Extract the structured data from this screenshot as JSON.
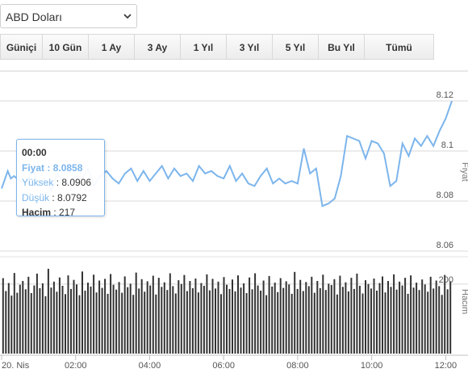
{
  "currency_select": {
    "value": "ABD Doları"
  },
  "range_tabs": [
    {
      "label": "Güniçi",
      "active": true
    },
    {
      "label": "10 Gün",
      "active": false
    },
    {
      "label": "1 Ay",
      "active": false
    },
    {
      "label": "3 Ay",
      "active": false
    },
    {
      "label": "1 Yıl",
      "active": false
    },
    {
      "label": "3 Yıl",
      "active": false
    },
    {
      "label": "5 Yıl",
      "active": false
    },
    {
      "label": "Bu Yıl",
      "active": false
    },
    {
      "label": "Tümü",
      "active": false
    }
  ],
  "tooltip": {
    "time": "00:00",
    "price_label": "Fiyat",
    "price_value": "8.0858",
    "high_label": "Yüksek",
    "high_value": "8.0906",
    "low_label": "Düşük",
    "low_value": "8.0792",
    "volume_label": "Hacim",
    "volume_value": "217"
  },
  "chart_data": [
    {
      "type": "line",
      "ylabel": "Fiyat",
      "ylim": [
        8.06,
        8.13
      ],
      "yticks": [
        "8.06",
        "8.08",
        "8.1",
        "8.12"
      ],
      "color": "#7cb5ec",
      "x": [
        "00:00",
        "00:10",
        "00:15",
        "00:20",
        "00:30",
        "00:40",
        "00:50",
        "01:00",
        "01:10",
        "01:20",
        "01:30",
        "01:40",
        "01:50",
        "02:00",
        "02:10",
        "02:20",
        "02:30",
        "02:40",
        "02:50",
        "03:00",
        "03:10",
        "03:20",
        "03:30",
        "03:40",
        "03:50",
        "04:00",
        "04:10",
        "04:20",
        "04:30",
        "04:40",
        "04:50",
        "05:00",
        "05:10",
        "05:20",
        "05:30",
        "05:40",
        "05:50",
        "06:00",
        "06:10",
        "06:20",
        "06:30",
        "06:40",
        "06:50",
        "07:00",
        "07:10",
        "07:20",
        "07:30",
        "07:40",
        "07:50",
        "08:00",
        "08:10",
        "08:20",
        "08:30",
        "08:40",
        "08:50",
        "09:00",
        "09:10",
        "09:20",
        "09:30",
        "09:40",
        "09:50",
        "10:00",
        "10:10",
        "10:20",
        "10:30",
        "10:40",
        "10:50",
        "11:00",
        "11:10",
        "11:20",
        "11:30",
        "11:40",
        "11:50",
        "12:00",
        "12:10"
      ],
      "values": [
        8.085,
        8.092,
        8.089,
        8.09,
        8.088,
        8.087,
        8.093,
        8.086,
        8.089,
        8.084,
        8.091,
        8.088,
        8.087,
        8.09,
        8.089,
        8.093,
        8.086,
        8.09,
        8.092,
        8.089,
        8.087,
        8.091,
        8.093,
        8.088,
        8.092,
        8.088,
        8.091,
        8.094,
        8.089,
        8.093,
        8.09,
        8.091,
        8.088,
        8.094,
        8.091,
        8.092,
        8.09,
        8.089,
        8.094,
        8.088,
        8.091,
        8.087,
        8.086,
        8.09,
        8.093,
        8.087,
        8.089,
        8.087,
        8.088,
        8.087,
        8.101,
        8.091,
        8.093,
        8.078,
        8.079,
        8.081,
        8.09,
        8.106,
        8.105,
        8.104,
        8.097,
        8.104,
        8.103,
        8.099,
        8.086,
        8.088,
        8.103,
        8.098,
        8.105,
        8.102,
        8.106,
        8.102,
        8.108,
        8.113,
        8.12
      ],
      "xticks": [
        "20. Nis",
        "02:00",
        "04:00",
        "06:00",
        "08:00",
        "10:00",
        "12:00"
      ],
      "xtick_values": [
        "00:00",
        "02:00",
        "04:00",
        "06:00",
        "08:00",
        "10:00",
        "12:00"
      ]
    },
    {
      "type": "bar",
      "ylabel": "Hacim",
      "ylim": [
        0,
        260
      ],
      "yticks": [
        "200"
      ],
      "color": "#333333",
      "values": [
        217,
        180,
        203,
        167,
        232,
        175,
        198,
        209,
        185,
        221,
        174,
        196,
        230,
        188,
        202,
        165,
        244,
        190,
        207,
        178,
        219,
        195,
        171,
        225,
        186,
        212,
        199,
        168,
        236,
        181,
        204,
        193,
        227,
        176,
        210,
        189,
        215,
        172,
        229,
        198,
        184,
        206,
        175,
        222,
        191,
        201,
        169,
        233,
        187,
        214,
        178,
        208,
        196,
        224,
        170,
        218,
        192,
        205,
        183,
        231,
        194,
        173,
        211,
        200,
        226,
        180,
        209,
        188,
        216,
        176,
        203,
        195,
        228,
        182,
        215,
        187,
        207,
        171,
        220,
        198,
        186,
        213,
        179,
        225,
        190,
        202,
        174,
        219,
        185,
        231,
        196,
        181,
        210,
        168,
        223,
        193,
        204,
        177,
        217,
        189,
        208,
        199,
        172,
        235,
        186,
        212,
        180,
        206,
        194,
        221,
        175,
        209,
        188,
        227,
        183,
        201,
        197,
        214,
        170,
        224,
        192,
        205,
        179,
        218,
        186,
        230,
        195,
        173,
        211,
        200,
        187,
        216,
        181,
        203,
        222,
        176,
        209,
        192,
        228,
        184,
        207,
        196,
        218,
        172,
        225,
        190,
        204,
        183,
        213,
        199,
        178,
        221,
        187,
        210,
        194,
        169,
        226,
        185,
        208
      ]
    }
  ]
}
